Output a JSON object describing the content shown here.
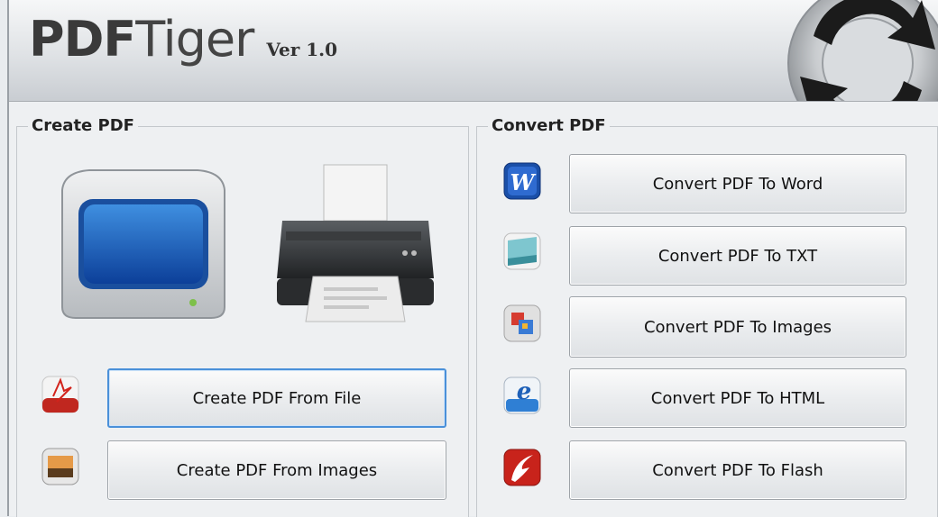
{
  "app": {
    "brand_bold": "PDF",
    "brand_light": "Tiger",
    "version": "Ver 1.0"
  },
  "create": {
    "title": "Create PDF",
    "buttons": [
      {
        "label": "Create PDF From File",
        "icon": "pdf-file-icon"
      },
      {
        "label": "Create PDF From Images",
        "icon": "image-icon"
      }
    ],
    "illustrations": [
      "monitor-icon",
      "printer-icon"
    ]
  },
  "convert": {
    "title": "Convert PDF",
    "buttons": [
      {
        "label": "Convert PDF To Word",
        "icon": "word-icon"
      },
      {
        "label": "Convert PDF To TXT",
        "icon": "txt-icon"
      },
      {
        "label": "Convert PDF To Images",
        "icon": "images-icon"
      },
      {
        "label": "Convert PDF To HTML",
        "icon": "html-icon"
      },
      {
        "label": "Convert PDF To Flash",
        "icon": "flash-icon"
      }
    ]
  }
}
